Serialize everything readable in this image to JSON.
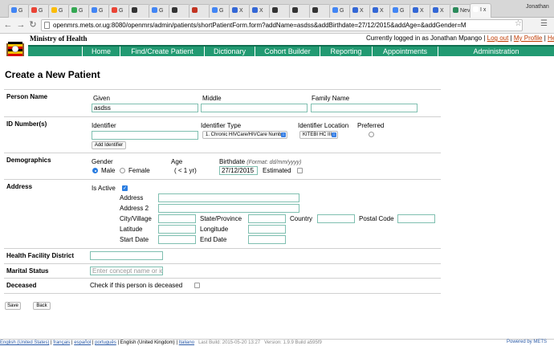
{
  "browser": {
    "tabs": [
      {
        "label": "G",
        "color": "#4285f4"
      },
      {
        "label": "G",
        "color": "#ea4335"
      },
      {
        "label": "G",
        "color": "#fbbc05"
      },
      {
        "label": "G",
        "color": "#34a853"
      },
      {
        "label": "G",
        "color": "#4285f4"
      },
      {
        "label": "G",
        "color": "#ea4335"
      },
      {
        "label": "",
        "color": "#333333"
      },
      {
        "label": "G",
        "color": "#4285f4"
      },
      {
        "label": "",
        "color": "#333333"
      },
      {
        "label": "",
        "color": "#c23321"
      },
      {
        "label": "G",
        "color": "#4285f4"
      },
      {
        "label": "X",
        "color": "#3367d6"
      },
      {
        "label": "X",
        "color": "#3367d6"
      },
      {
        "label": "",
        "color": "#333333"
      },
      {
        "label": "",
        "color": "#333333"
      },
      {
        "label": "",
        "color": "#333333"
      },
      {
        "label": "G",
        "color": "#4285f4"
      },
      {
        "label": "X",
        "color": "#3367d6"
      },
      {
        "label": "X",
        "color": "#3367d6"
      },
      {
        "label": "G",
        "color": "#4285f4"
      },
      {
        "label": "X",
        "color": "#3367d6"
      },
      {
        "label": "X",
        "color": "#3367d6"
      },
      {
        "label": "Nev",
        "color": "#2a8a5a"
      },
      {
        "label": "I x",
        "color": "#ffffff"
      }
    ],
    "user": "Jonathan",
    "url": "openmrs.mets.or.ug:8080/openmrs/admin/patients/shortPatientForm.form?addName=asdss&addBirthdate=27/12/2015&addAge=&addGender=M"
  },
  "header": {
    "ministry": "Ministry of Health",
    "logged_in": "Currently logged in as Jonathan Mpango",
    "logout": "Log out",
    "my_profile": "My Profile",
    "help": "Help"
  },
  "nav": [
    "Home",
    "Find/Create Patient",
    "Dictionary",
    "Cohort Builder",
    "Reporting",
    "Appointments",
    "Administration"
  ],
  "page": {
    "title": "Create a New Patient",
    "person_name": {
      "section": "Person Name",
      "given_label": "Given",
      "middle_label": "Middle",
      "family_label": "Family Name",
      "given_value": "asdss",
      "middle_value": "",
      "family_value": ""
    },
    "identifiers": {
      "section": "ID Number(s)",
      "identifier_label": "Identifier",
      "type_label": "Identifier Type",
      "location_label": "Identifier Location",
      "preferred_label": "Preferred",
      "type_value": "1. Chronic HIVCare/HIVCare Number",
      "location_value": "KITEBI HC III",
      "add_button": "Add Identifier"
    },
    "demographics": {
      "section": "Demographics",
      "gender_label": "Gender",
      "male": "Male",
      "female": "Female",
      "age_label": "Age",
      "age_value": "( < 1 yr)",
      "birthdate_label": "Birthdate",
      "birthdate_format": "(Format: dd/mm/yyyy)",
      "birthdate_value": "27/12/2015",
      "estimated": "Estimated"
    },
    "address": {
      "section": "Address",
      "is_active": "Is Active",
      "address": "Address",
      "address2": "Address 2",
      "city": "City/Village",
      "state": "State/Province",
      "country": "Country",
      "postal": "Postal Code",
      "latitude": "Latitude",
      "longitude": "Longitude",
      "start_date": "Start Date",
      "end_date": "End Date"
    },
    "health_facility_district": "Health Facility District",
    "marital_status": {
      "label": "Marital Status",
      "placeholder": "Enter concept name or id"
    },
    "deceased": {
      "label": "Deceased",
      "check_text": "Check if this person is deceased"
    },
    "save": "Save",
    "back": "Back"
  },
  "footer": {
    "lang_en_us": "English (United States)",
    "lang_fr": "français",
    "lang_es": "español",
    "lang_pt": "português",
    "lang_en_gb": "English (United Kingdom)",
    "lang_it": "Italiano",
    "build": "Last Build: 2015-05-20 13:27",
    "version": "Version: 1.9.9 Build a595f9",
    "powered": "Powered by METS"
  }
}
